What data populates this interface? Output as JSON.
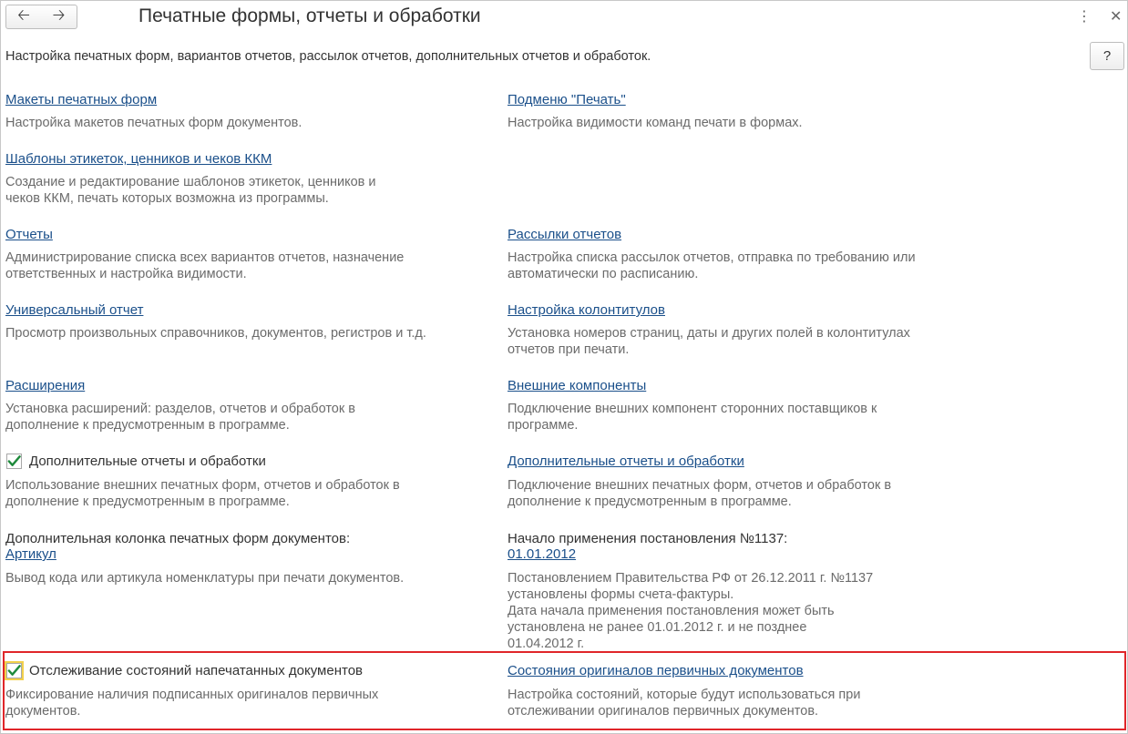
{
  "header": {
    "title": "Печатные формы, отчеты и обработки",
    "back_icon": "arrow-left-icon",
    "forward_icon": "arrow-right-icon",
    "more_icon": "more-vertical-icon",
    "close_icon": "close-icon",
    "help_label": "?"
  },
  "subtitle": "Настройка печатных форм, вариантов отчетов, рассылок отчетов, дополнительных отчетов и обработок.",
  "left": {
    "print_layouts": {
      "link": "Макеты печатных форм",
      "desc": [
        "Настройка макетов печатных форм документов."
      ]
    },
    "label_templates": {
      "link": "Шаблоны этикеток, ценников и чеков ККМ",
      "desc": [
        "Создание и редактирование шаблонов этикеток, ценников и",
        "чеков ККМ, печать которых возможна из программы."
      ]
    },
    "reports": {
      "link": "Отчеты",
      "desc": [
        "Администрирование списка всех вариантов отчетов, назначение",
        "ответственных и настройка видимости."
      ]
    },
    "universal_report": {
      "link": "Универсальный отчет",
      "desc": [
        "Просмотр произвольных справочников, документов, регистров и т.д."
      ]
    },
    "extensions": {
      "link": "Расширения",
      "desc": [
        "Установка расширений: разделов, отчетов и обработок в",
        "дополнение к предусмотренным в программе."
      ]
    },
    "additional_reports": {
      "checked": true,
      "label": "Дополнительные отчеты и обработки",
      "desc": [
        "Использование внешних печатных форм, отчетов и обработок в",
        "дополнение к предусмотренным в программе."
      ]
    },
    "extra_column": {
      "label": "Дополнительная колонка печатных форм документов:",
      "value": "Артикул",
      "desc": [
        "Вывод кода или артикула номенклатуры при печати документов."
      ]
    },
    "tracking": {
      "checked": true,
      "label": "Отслеживание состояний напечатанных документов",
      "desc": [
        "Фиксирование наличия подписанных оригиналов первичных",
        "документов."
      ]
    }
  },
  "right": {
    "print_submenu": {
      "link": "Подменю \"Печать\"",
      "desc": [
        "Настройка видимости команд печати в формах."
      ]
    },
    "report_mailings": {
      "link": "Рассылки отчетов",
      "desc": [
        "Настройка списка рассылок отчетов, отправка по требованию или",
        "автоматически по расписанию."
      ]
    },
    "headers_footers": {
      "link": "Настройка колонтитулов",
      "desc": [
        "Установка номеров страниц, даты и других полей в колонтитулах",
        "отчетов при печати."
      ]
    },
    "external_components": {
      "link": "Внешние компоненты",
      "desc": [
        "Подключение внешних компонент сторонних поставщиков к",
        "программе."
      ]
    },
    "additional_reports": {
      "link": "Дополнительные отчеты и обработки",
      "desc": [
        "Подключение внешних печатных форм, отчетов и обработок в",
        "дополнение к предусмотренным в программе."
      ]
    },
    "resolution_1137": {
      "label": "Начало применения постановления №1137:",
      "value": "01.01.2012",
      "desc": [
        "Постановлением Правительства РФ от 26.12.2011 г. №1137",
        "установлены формы счета-фактуры.",
        "Дата начала применения постановления может быть",
        "установлена не ранее 01.01.2012 г. и не позднее",
        "01.04.2012 г."
      ]
    },
    "original_states": {
      "link": "Состояния оригиналов первичных документов",
      "desc": [
        "Настройка состояний, которые будут использоваться при",
        "отслеживании оригиналов первичных документов."
      ]
    }
  }
}
